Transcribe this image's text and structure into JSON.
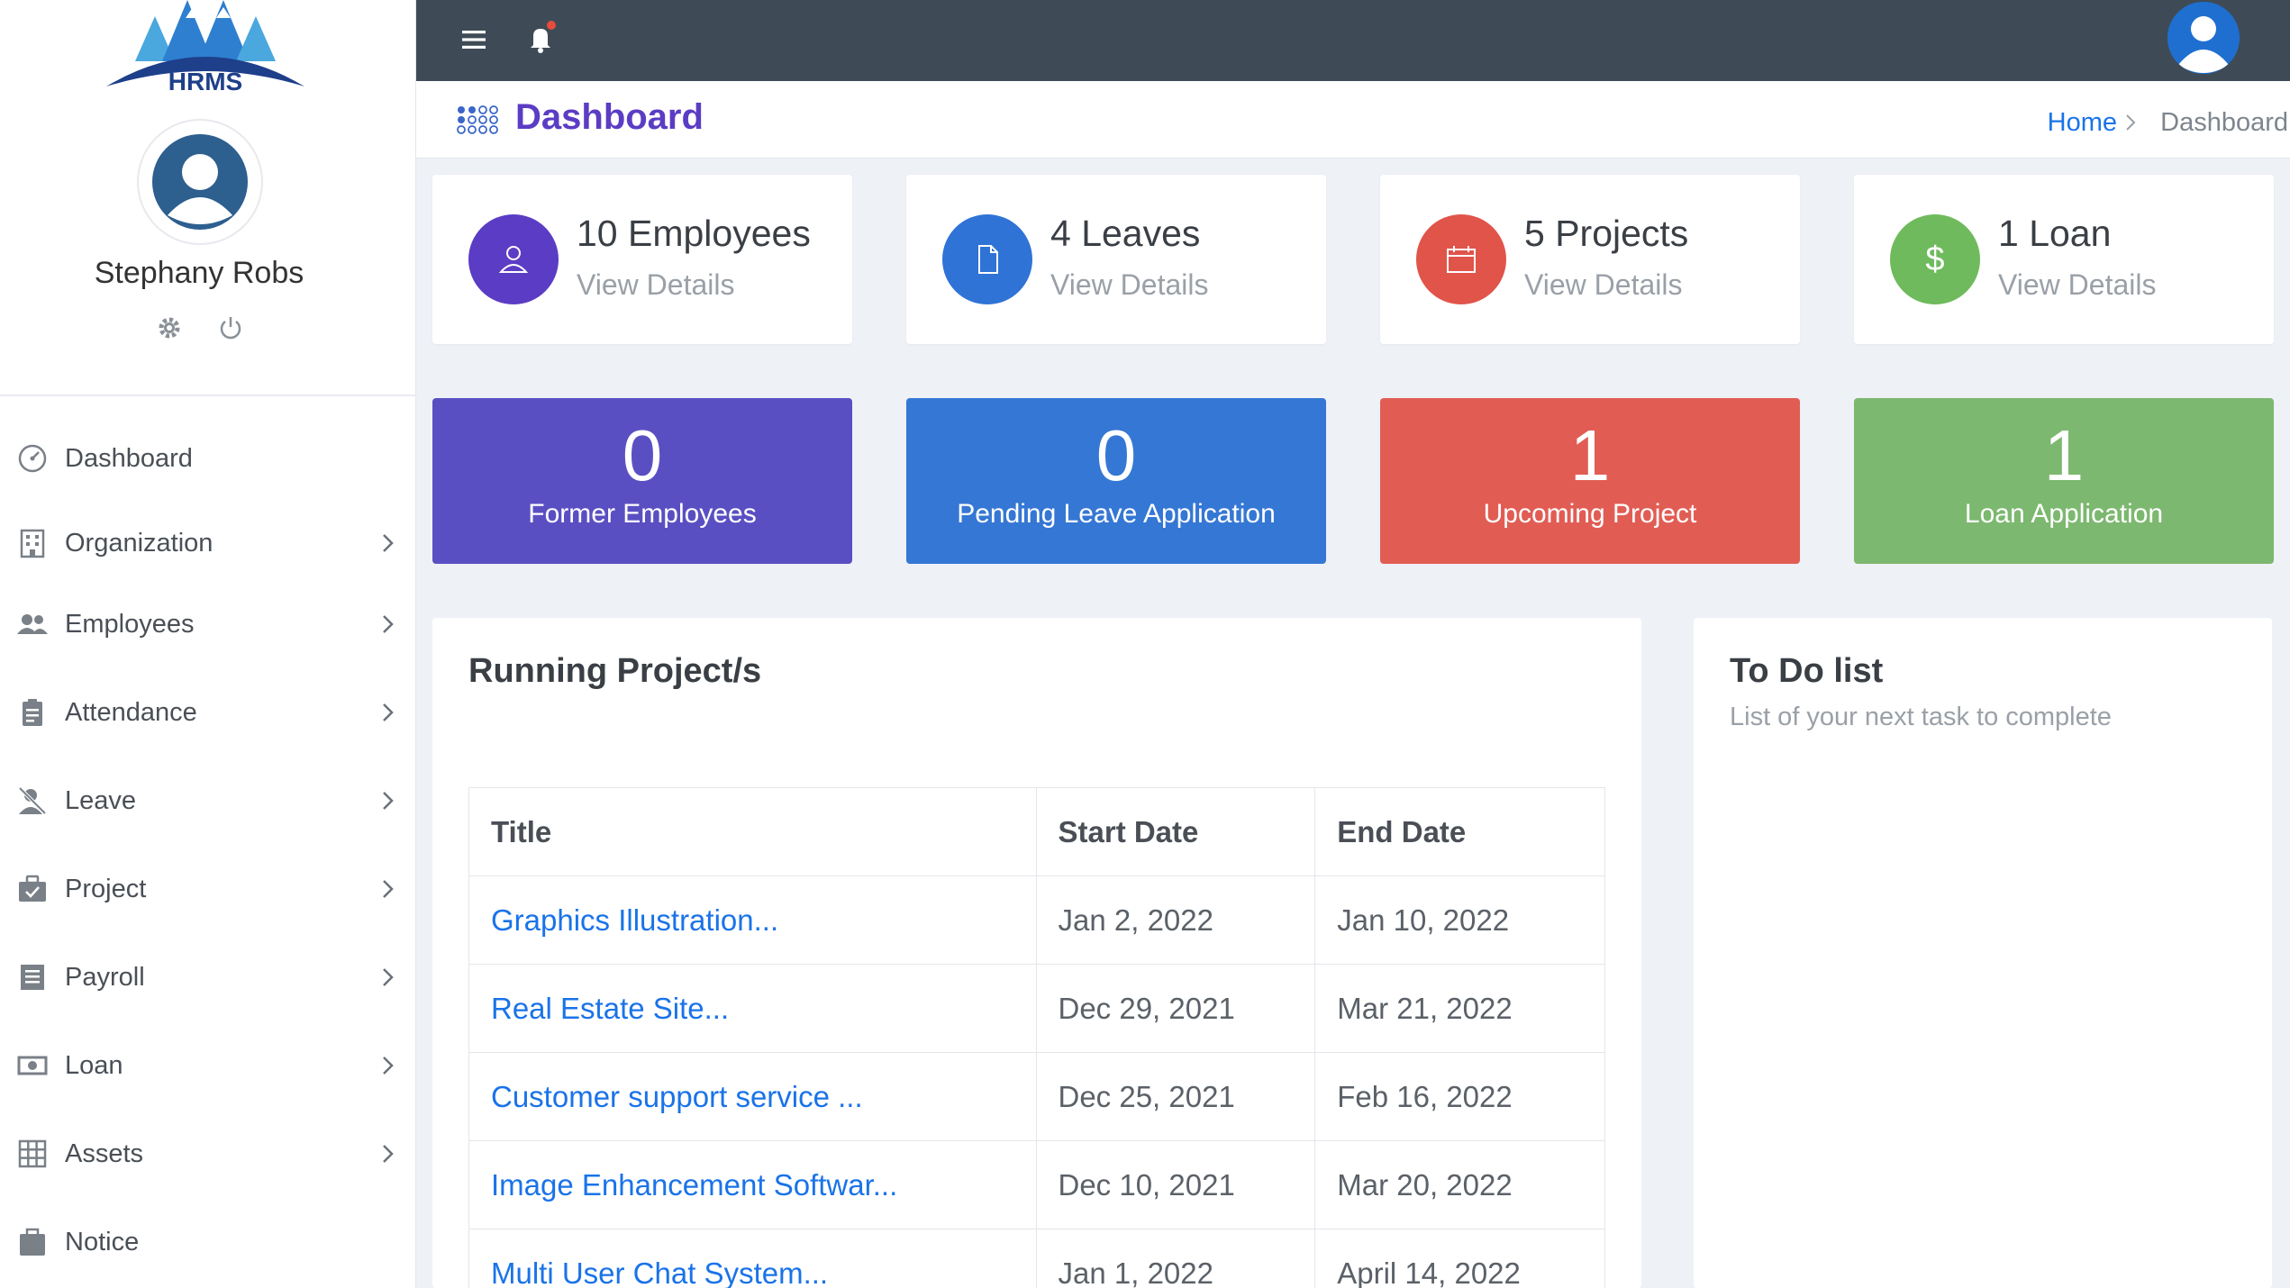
{
  "brand": {
    "logo_text": "HRMS"
  },
  "user": {
    "name": "Stephany Robs"
  },
  "sidebar": {
    "items": [
      {
        "label": "Dashboard",
        "icon": "dashboard-icon",
        "has_submenu": false
      },
      {
        "label": "Organization",
        "icon": "building-icon",
        "has_submenu": true
      },
      {
        "label": "Employees",
        "icon": "people-icon",
        "has_submenu": true
      },
      {
        "label": "Attendance",
        "icon": "clipboard-icon",
        "has_submenu": true
      },
      {
        "label": "Leave",
        "icon": "person-off-icon",
        "has_submenu": true
      },
      {
        "label": "Project",
        "icon": "briefcase-icon",
        "has_submenu": true
      },
      {
        "label": "Payroll",
        "icon": "list-icon",
        "has_submenu": true
      },
      {
        "label": "Loan",
        "icon": "money-icon",
        "has_submenu": true
      },
      {
        "label": "Assets",
        "icon": "grid-icon",
        "has_submenu": true
      },
      {
        "label": "Notice",
        "icon": "notice-icon",
        "has_submenu": false
      }
    ]
  },
  "header": {
    "title": "Dashboard",
    "breadcrumb": {
      "home": "Home",
      "current": "Dashboard"
    }
  },
  "stats": [
    {
      "title": "10 Employees",
      "link": "View Details",
      "color": "#5b3cc4",
      "icon": "person-icon"
    },
    {
      "title": "4 Leaves",
      "link": "View Details",
      "color": "#2f73d6",
      "icon": "document-icon"
    },
    {
      "title": "5 Projects",
      "link": "View Details",
      "color": "#e0544a",
      "icon": "calendar-icon"
    },
    {
      "title": "1 Loan",
      "link": "View Details",
      "color": "#6fba5c",
      "icon": "dollar-icon"
    }
  ],
  "blocks": [
    {
      "value": "0",
      "label": "Former Employees",
      "color": "#5a4fc2"
    },
    {
      "value": "0",
      "label": "Pending Leave Application",
      "color": "#3577d4"
    },
    {
      "value": "1",
      "label": "Upcoming Project",
      "color": "#e15d54"
    },
    {
      "value": "1",
      "label": "Loan Application",
      "color": "#7cb86f"
    }
  ],
  "projects": {
    "title": "Running Project/s",
    "columns": [
      "Title",
      "Start Date",
      "End Date"
    ],
    "rows": [
      {
        "title": "Graphics Illustration...",
        "start": "Jan 2, 2022",
        "end": "Jan 10, 2022"
      },
      {
        "title": "Real Estate Site...",
        "start": "Dec 29, 2021",
        "end": "Mar 21, 2022"
      },
      {
        "title": "Customer support service ...",
        "start": "Dec 25, 2021",
        "end": "Feb 16, 2022"
      },
      {
        "title": "Image Enhancement Softwar...",
        "start": "Dec 10, 2021",
        "end": "Mar 20, 2022"
      },
      {
        "title": "Multi User Chat System...",
        "start": "Jan 1, 2022",
        "end": "April 14, 2022"
      }
    ]
  },
  "todo": {
    "title": "To Do list",
    "subtitle": "List of your next task to complete"
  }
}
